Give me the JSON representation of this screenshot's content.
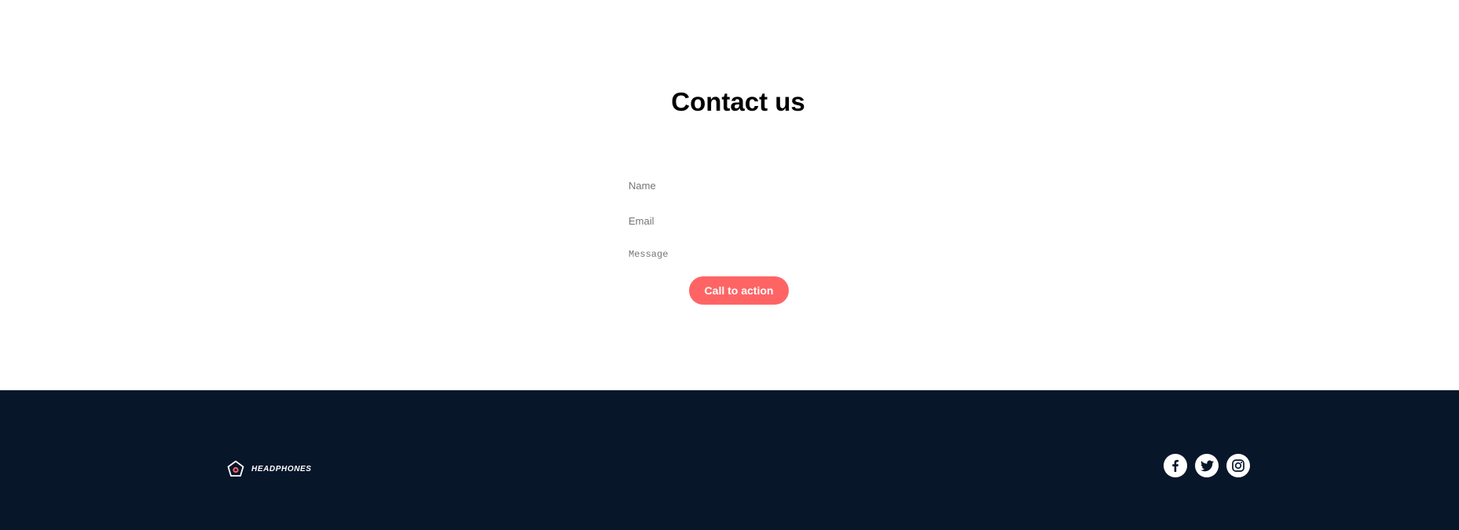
{
  "contact": {
    "title": "Contact us",
    "name_placeholder": "Name",
    "email_placeholder": "Email",
    "message_placeholder": "Message",
    "cta_label": "Call to action"
  },
  "footer": {
    "logo_text": "HEADPHONES",
    "socials": [
      {
        "icon": "facebook-icon"
      },
      {
        "icon": "twitter-icon"
      },
      {
        "icon": "instagram-icon"
      }
    ]
  },
  "colors": {
    "accent": "#ff6465",
    "footer_bg": "#08162a",
    "text": "#000000",
    "placeholder": "#757575"
  }
}
